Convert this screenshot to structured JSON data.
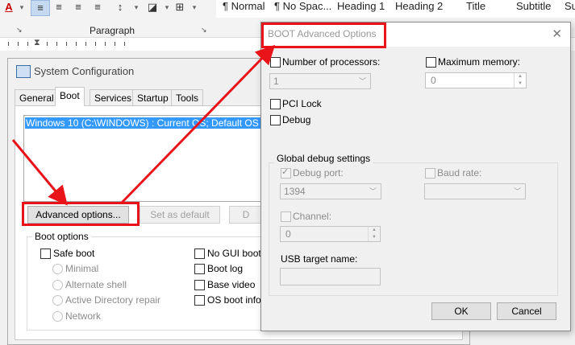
{
  "ribbon": {
    "paragraph_group": "Paragraph",
    "styles": [
      "¶ Normal",
      "¶ No Spac...",
      "Heading 1",
      "Heading 2",
      "Title",
      "Subtitle",
      "Su"
    ],
    "font_color_letter": "A",
    "dialog_launcher": "↘"
  },
  "sysconfig": {
    "title": "System Configuration",
    "tabs": [
      "General",
      "Boot",
      "Services",
      "Startup",
      "Tools"
    ],
    "active_tab": "Boot",
    "os_entry": "Windows 10 (C:\\WINDOWS) : Current OS; Default OS",
    "buttons": {
      "advanced": "Advanced options...",
      "set_default": "Set as default",
      "delete": "D"
    },
    "boot_options": {
      "label": "Boot options",
      "safe_boot": "Safe boot",
      "minimal": "Minimal",
      "alternate_shell": "Alternate shell",
      "ad_repair": "Active Directory repair",
      "network": "Network",
      "no_gui": "No GUI boot",
      "boot_log": "Boot log",
      "base_video": "Base video",
      "os_boot_info": "OS boot inform"
    }
  },
  "advanced_dialog": {
    "title": "BOOT Advanced Options",
    "close_glyph": "✕",
    "num_processors_label": "Number of processors:",
    "num_processors_value": "1",
    "max_memory_label": "Maximum memory:",
    "max_memory_value": "0",
    "pci_lock_label": "PCI Lock",
    "debug_label": "Debug",
    "global_debug_label": "Global debug settings",
    "debug_port_label": "Debug port:",
    "debug_port_value": "1394",
    "baud_rate_label": "Baud rate:",
    "channel_label": "Channel:",
    "channel_value": "0",
    "usb_target_label": "USB target name:",
    "ok": "OK",
    "cancel": "Cancel"
  },
  "colors": {
    "annotation_red": "#e8141a",
    "selection_blue": "#3399ff"
  }
}
